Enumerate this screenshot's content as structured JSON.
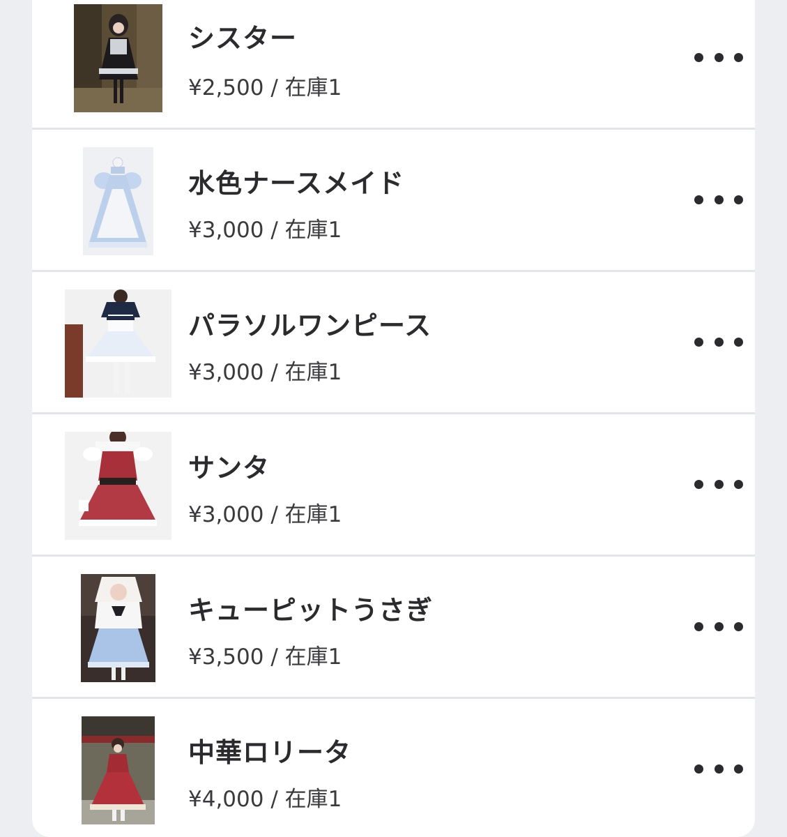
{
  "products": [
    {
      "name": "シスター",
      "price": "¥2,500",
      "separator": "/",
      "stock": "在庫1",
      "image": "sister-costume-photo",
      "more_icon": "ellipsis-icon"
    },
    {
      "name": "水色ナースメイド",
      "price": "¥3,000",
      "separator": "/",
      "stock": "在庫1",
      "image": "light-blue-nurse-maid-costume-photo",
      "more_icon": "ellipsis-icon"
    },
    {
      "name": "パラソルワンピース",
      "price": "¥3,000",
      "separator": "/",
      "stock": "在庫1",
      "image": "parasol-dress-photo",
      "more_icon": "ellipsis-icon"
    },
    {
      "name": "サンタ",
      "price": "¥3,000",
      "separator": "/",
      "stock": "在庫1",
      "image": "santa-costume-photo",
      "more_icon": "ellipsis-icon"
    },
    {
      "name": "キューピットうさぎ",
      "price": "¥3,500",
      "separator": "/",
      "stock": "在庫1",
      "image": "cupid-bunny-costume-photo",
      "more_icon": "ellipsis-icon"
    },
    {
      "name": "中華ロリータ",
      "price": "¥4,000",
      "separator": "/",
      "stock": "在庫1",
      "image": "chinese-lolita-costume-photo",
      "more_icon": "ellipsis-icon"
    }
  ],
  "colors": {
    "background": "#edeef2",
    "card": "#ffffff",
    "text": "#2b2b2e",
    "divider": "#e3e4e8"
  }
}
